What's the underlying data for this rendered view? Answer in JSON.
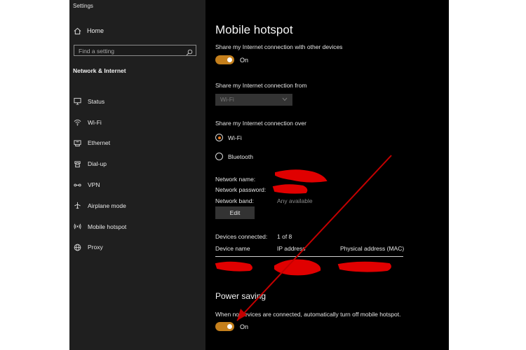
{
  "window": {
    "title": "Settings"
  },
  "sidebar": {
    "home_label": "Home",
    "search_placeholder": "Find a setting",
    "section_heading": "Network & Internet",
    "items": [
      {
        "label": "Status",
        "icon": "status-icon"
      },
      {
        "label": "Wi-Fi",
        "icon": "wifi-icon"
      },
      {
        "label": "Ethernet",
        "icon": "ethernet-icon"
      },
      {
        "label": "Dial-up",
        "icon": "dialup-icon"
      },
      {
        "label": "VPN",
        "icon": "vpn-icon"
      },
      {
        "label": "Airplane mode",
        "icon": "airplane-icon"
      },
      {
        "label": "Mobile hotspot",
        "icon": "hotspot-icon"
      },
      {
        "label": "Proxy",
        "icon": "globe-icon"
      }
    ]
  },
  "main": {
    "title": "Mobile hotspot",
    "share_label": "Share my Internet connection with other devices",
    "share_toggle": {
      "state": "On",
      "on": true
    },
    "share_from_label": "Share my Internet connection from",
    "share_from_value": "Wi-Fi",
    "share_over_label": "Share my Internet connection over",
    "share_over_options": [
      {
        "label": "Wi-Fi",
        "selected": true
      },
      {
        "label": "Bluetooth",
        "selected": false
      }
    ],
    "network_name_label": "Network name:",
    "network_password_label": "Network password:",
    "network_band_label": "Network band:",
    "network_band_value": "Any available",
    "edit_label": "Edit",
    "devices_connected_label": "Devices connected:",
    "devices_connected_value": "1 of 8",
    "table_headers": [
      "Device name",
      "IP address",
      "Physical address (MAC)"
    ],
    "power_saving": {
      "heading": "Power saving",
      "description": "When no devices are connected, automatically turn off mobile hotspot.",
      "toggle": {
        "state": "On",
        "on": true
      }
    }
  },
  "colors": {
    "accent": "#c47f1c",
    "radio_accent": "#ea7a1c",
    "annotation_red": "#e00000",
    "sidebar_bg": "#1f1f1f",
    "content_bg": "#000000"
  }
}
